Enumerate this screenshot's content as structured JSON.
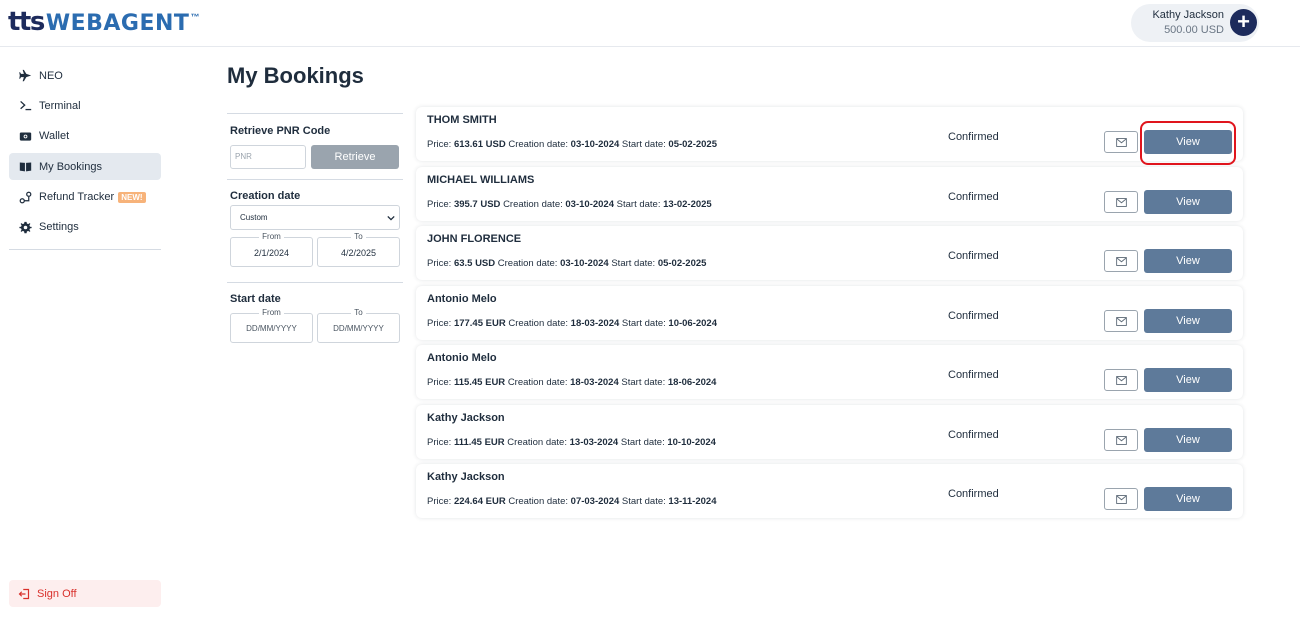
{
  "app": {
    "logo_main": "tts",
    "logo_sub": "WEBAGENT",
    "logo_tm": "™"
  },
  "user": {
    "name": "Kathy Jackson",
    "balance": "500.00 USD",
    "add_label": "+"
  },
  "sidebar": {
    "items": [
      {
        "label": "NEO",
        "icon": "plane-icon"
      },
      {
        "label": "Terminal",
        "icon": "terminal-icon"
      },
      {
        "label": "Wallet",
        "icon": "wallet-icon"
      },
      {
        "label": "My Bookings",
        "icon": "book-icon",
        "active": true
      },
      {
        "label": "Refund Tracker",
        "icon": "refund-icon",
        "badge": "NEW!"
      },
      {
        "label": "Settings",
        "icon": "gear-icon"
      }
    ],
    "sign_off": "Sign Off"
  },
  "page": {
    "title": "My Bookings"
  },
  "filters": {
    "pnr": {
      "label": "Retrieve PNR Code",
      "placeholder": "PNR",
      "button": "Retrieve"
    },
    "creation_date": {
      "label": "Creation date",
      "selected": "Custom",
      "from_legend": "From",
      "from_value": "2/1/2024",
      "to_legend": "To",
      "to_value": "4/2/2025"
    },
    "start_date": {
      "label": "Start date",
      "from_legend": "From",
      "from_value": "DD/MM/YYYY",
      "to_legend": "To",
      "to_value": "DD/MM/YYYY"
    }
  },
  "booking_labels": {
    "price": "Price:",
    "creation": "Creation date:",
    "start": "Start date:",
    "view": "View"
  },
  "bookings": [
    {
      "name": "THOM SMITH",
      "price": "613.61 USD",
      "creation_date": "03-10-2024",
      "start_date": "05-02-2025",
      "status": "Confirmed"
    },
    {
      "name": "MICHAEL WILLIAMS",
      "price": "395.7 USD",
      "creation_date": "03-10-2024",
      "start_date": "13-02-2025",
      "status": "Confirmed"
    },
    {
      "name": "JOHN FLORENCE",
      "price": "63.5 USD",
      "creation_date": "03-10-2024",
      "start_date": "05-02-2025",
      "status": "Confirmed"
    },
    {
      "name": "Antonio Melo",
      "price": "177.45 EUR",
      "creation_date": "18-03-2024",
      "start_date": "10-06-2024",
      "status": "Confirmed"
    },
    {
      "name": "Antonio Melo",
      "price": "115.45 EUR",
      "creation_date": "18-03-2024",
      "start_date": "18-06-2024",
      "status": "Confirmed"
    },
    {
      "name": "Kathy Jackson",
      "price": "111.45 EUR",
      "creation_date": "13-03-2024",
      "start_date": "10-10-2024",
      "status": "Confirmed"
    },
    {
      "name": "Kathy Jackson",
      "price": "224.64 EUR",
      "creation_date": "07-03-2024",
      "start_date": "13-11-2024",
      "status": "Confirmed"
    }
  ],
  "colors": {
    "brand_dark": "#1d2b5c",
    "brand_blue": "#2b6cb0",
    "view_button": "#5e7a9a",
    "highlight": "#e0151d",
    "sign_off": "#d9302b"
  }
}
